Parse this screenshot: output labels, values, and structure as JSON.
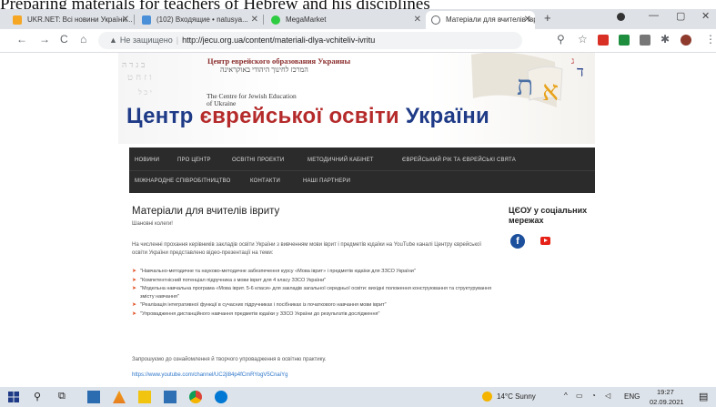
{
  "caption": "Preparing materials for teachers of Hebrew and his disciplines",
  "browser": {
    "tabs": [
      {
        "label": "UKR.NET: Всі новини України...",
        "favicon_color": "#f5a623",
        "active": false
      },
      {
        "label": "(102) Входящие • natusya...",
        "favicon_color": "#4a90d9",
        "active": false
      },
      {
        "label": "MegaMarket",
        "favicon_color": "#2ecc40",
        "active": false
      },
      {
        "label": "Матеріали для вчителів іврит",
        "favicon_color": "#5f6368",
        "active": true
      }
    ],
    "new_tab_icon": "+",
    "address": {
      "warning_label": "Не защищено",
      "url": "http://jecu.org.ua/content/materiali-dlya-vchiteliv-ivritu"
    }
  },
  "site": {
    "header": {
      "ru_title": "Центр еврейского образования Украины",
      "he_title": "המרכז לחינוך היהודי באוקראינה",
      "en_title_line1": "The Centre for Jewish Education",
      "en_title_line2": "of Ukraine",
      "main_title_part1": "Центр ",
      "main_title_part2": "єврейської освіти ",
      "main_title_part3": "України"
    },
    "nav": [
      "НОВИНИ",
      "ПРО ЦЕНТР",
      "ОСВІТНІ ПРОЕКТИ",
      "МЕТОДИЧНИЙ КАБІНЕТ",
      "ЄВРЕЙСЬКИЙ РІК ТА ЄВРЕЙСЬКІ СВЯТА",
      "МІЖНАРОДНЕ СПІВРОБІТНИЦТВО",
      "КОНТАКТИ",
      "НАШІ ПАРТНЕРИ"
    ],
    "content": {
      "title": "Матеріали для вчителів івриту",
      "greeting": "Шановні колеги!",
      "intro": "На численні прохання керівників закладів освіти України з вивченням мови іврит і предметів юдаїки на YouTube каналі Центру єврейської освіти України представлено відео-презентації на теми:",
      "items": [
        "\"Навчально-методичне та науково-методичне забезпечення курсу «Мова іврит» і предметів юдаїки для ЗЗСО України\"",
        "\"Компетентнісний потенціал підручника з мови іврит для 4 класу ЗЗСО України\"",
        "\"Модельна навчальна програма «Мова іврит. 5-6 класи» для закладів загальної середньої освіти: вихідні положення конструювання та структурування змісту навчання\"",
        "\"Реалізація інтегративної функції в сучасних підручниках і посібниках із початкового навчання мови іврит\"",
        "\"Упровадження дистанційного навчання предметів юдаїки у ЗЗСО України до результатів дослідження\""
      ],
      "invite": "Запрошуємо до ознайомлення й творчого упровадження в освітню практику.",
      "link": "https://www.youtube.com/channel/UC2jl84p4fCmRYogV5CnaiYg"
    },
    "sidebar": {
      "social_title": "ЦЄОУ у соціальних мережах",
      "facebook_icon": "f"
    }
  },
  "taskbar": {
    "weather": "14°C  Sunny",
    "lang": "ENG",
    "time": "19:27",
    "date": "02.09.2021"
  }
}
